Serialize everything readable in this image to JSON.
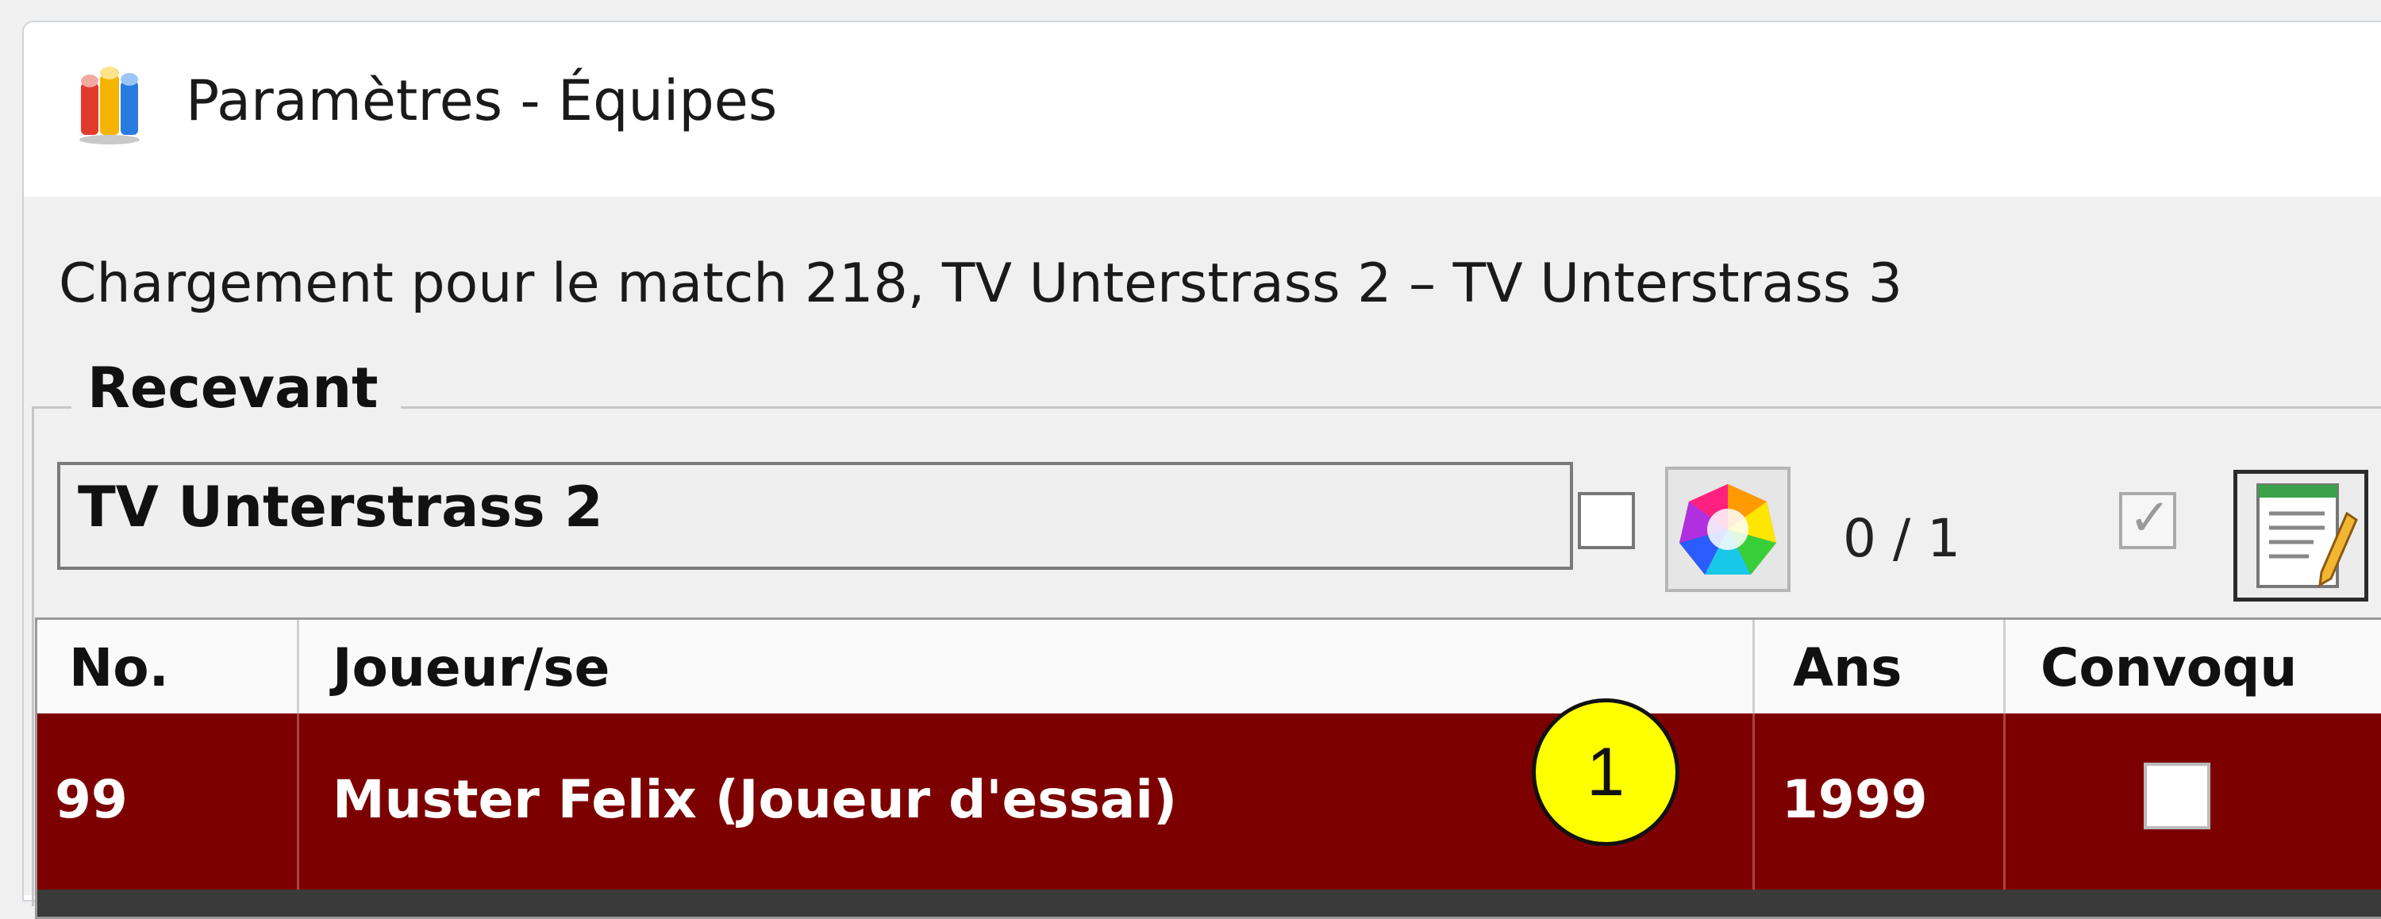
{
  "window": {
    "title": "Paramètres - Équipes"
  },
  "load_info": "Chargement pour le match 218, TV Unterstrass 2 – TV Unterstrass 3",
  "group": {
    "label": "Recevant",
    "team_name": "TV Unterstrass 2",
    "team_checkbox_checked": false,
    "color_button_icon": "color-wheel-icon",
    "counter": "0 / 1",
    "confirm_checkbox_checked": true,
    "edit_button_icon": "edit-document-icon"
  },
  "table": {
    "columns": [
      "No.",
      "Joueur/se",
      "Ans",
      "Convoqu"
    ],
    "rows": [
      {
        "number": "99",
        "player": "Muster Felix (Joueur d'essai)",
        "year": "1999",
        "convoque_checked": false
      }
    ],
    "selected_row_color": "#7d0000"
  },
  "callout": "1"
}
